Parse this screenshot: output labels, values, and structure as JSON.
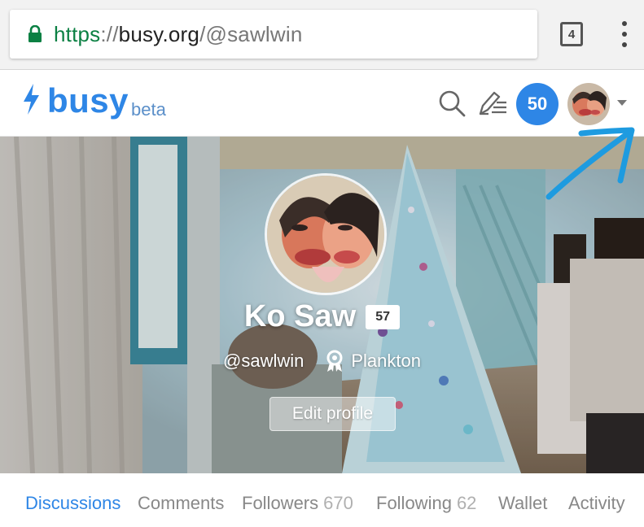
{
  "browser": {
    "url_scheme": "https",
    "url_sep": "://",
    "url_host": "busy.org",
    "url_path": "/@sawlwin",
    "tab_count": "4",
    "icons": [
      "lock-icon",
      "tabs-icon",
      "overflow-menu-icon"
    ]
  },
  "header": {
    "logo_word": "busy",
    "logo_badge": "beta",
    "notification_count": "50",
    "icons": [
      "bolt-icon",
      "search-icon",
      "write-icon",
      "chevron-down-icon"
    ],
    "brand_color": "#2e86e6"
  },
  "profile": {
    "name": "Ko Saw",
    "reputation": "57",
    "handle": "@sawlwin",
    "rank": "Plankton",
    "edit_label": "Edit profile"
  },
  "nav": {
    "items": [
      {
        "label": "Discussions",
        "count": "",
        "active": true
      },
      {
        "label": "Comments",
        "count": ""
      },
      {
        "label": "Followers",
        "count": "670"
      },
      {
        "label": "Following",
        "count": "62"
      },
      {
        "label": "Wallet",
        "count": ""
      },
      {
        "label": "Activity",
        "count": ""
      }
    ]
  },
  "annotation": {
    "color": "#1e9be0",
    "icon": "arrow-annotation"
  }
}
